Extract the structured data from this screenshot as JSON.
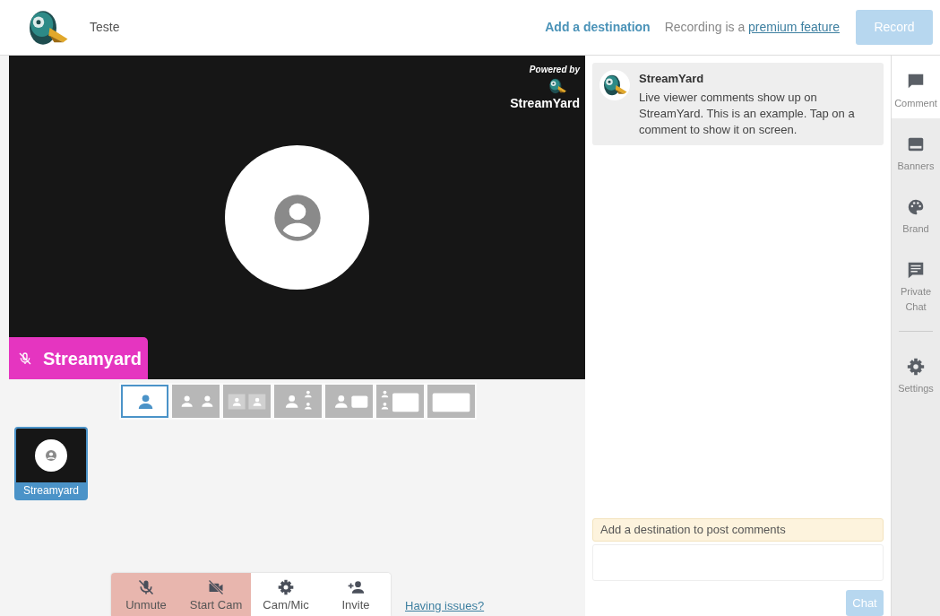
{
  "header": {
    "title": "Teste",
    "add_destination": "Add a destination",
    "recording_note": "Recording is a",
    "recording_link": "premium feature",
    "record_button": {
      "label": "Record",
      "disabled": true
    }
  },
  "stage": {
    "powered_by": "Powered by",
    "brand": "StreamYard",
    "name_tag": {
      "name": "Streamyard",
      "muted": true
    }
  },
  "layouts": [
    {
      "kind": "solo",
      "selected": true
    },
    {
      "kind": "split",
      "selected": false
    },
    {
      "kind": "group",
      "selected": false
    },
    {
      "kind": "leader",
      "selected": false
    },
    {
      "kind": "side",
      "selected": false
    },
    {
      "kind": "news",
      "selected": false
    },
    {
      "kind": "full",
      "selected": false
    }
  ],
  "participants": [
    {
      "name": "Streamyard",
      "selected": true
    }
  ],
  "controls": [
    {
      "kind": "mic",
      "label": "Unmute",
      "off": true
    },
    {
      "kind": "cam",
      "label": "Start Cam",
      "off": true
    },
    {
      "kind": "settings",
      "label": "Cam/Mic",
      "off": false
    },
    {
      "kind": "invite",
      "label": "Invite",
      "off": false
    }
  ],
  "help_link": "Having issues?",
  "comments": [
    {
      "author": "StreamYard",
      "text": "Live viewer comments show up on StreamYard. This is an example. Tap on a comment to show it on screen."
    }
  ],
  "comment_notice": "Add a destination to post comments",
  "chat_button": {
    "label": "Chat",
    "disabled": true
  },
  "sidebar": {
    "items": [
      {
        "kind": "comments",
        "label": "Comment",
        "selected": true
      },
      {
        "kind": "banners",
        "label": "Banners",
        "selected": false
      },
      {
        "kind": "brand",
        "label": "Brand",
        "selected": false
      },
      {
        "kind": "chat",
        "label": "Private Chat",
        "selected": false
      },
      {
        "kind": "settings",
        "label": "Settings",
        "selected": false
      }
    ]
  }
}
